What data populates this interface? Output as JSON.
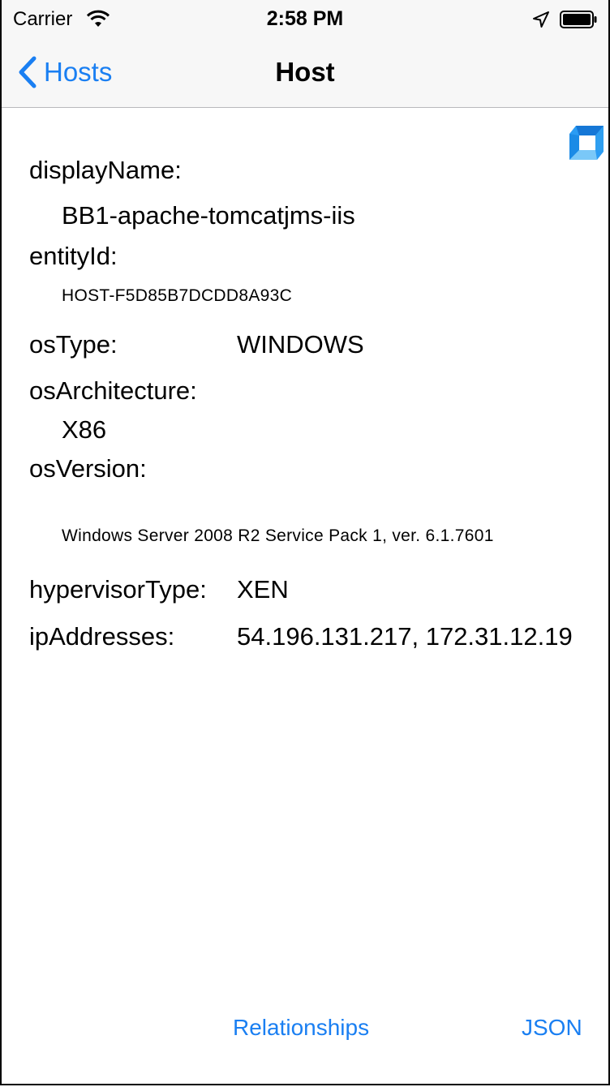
{
  "status_bar": {
    "carrier": "Carrier",
    "time": "2:58 PM"
  },
  "nav": {
    "back_label": "Hosts",
    "title": "Host"
  },
  "fields": {
    "display_name_label": "displayName:",
    "display_name_value": "BB1-apache-tomcatjms-iis",
    "entity_id_label": "entityId:",
    "entity_id_value": "HOST-F5D85B7DCDD8A93C",
    "os_type_label": "osType:",
    "os_type_value": "WINDOWS",
    "os_architecture_label": "osArchitecture:",
    "os_architecture_value": "X86",
    "os_version_label": "osVersion:",
    "os_version_value": "Windows Server 2008 R2 Service Pack 1, ver. 6.1.7601",
    "hypervisor_type_label": "hypervisorType:",
    "hypervisor_type_value": "XEN",
    "ip_addresses_label": "ipAddresses:",
    "ip_addresses_value": "54.196.131.217, 172.31.12.19"
  },
  "toolbar": {
    "relationships_label": "Relationships",
    "json_label": "JSON"
  },
  "colors": {
    "accent": "#1a7ff2",
    "logo": "#2a9cf4"
  }
}
